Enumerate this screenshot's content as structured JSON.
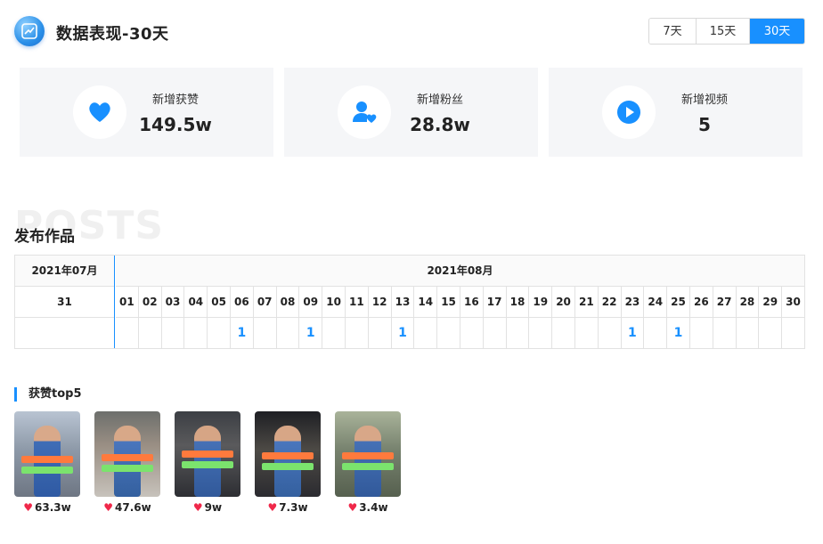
{
  "header": {
    "title": "数据表现-30天",
    "ranges": [
      "7天",
      "15天",
      "30天"
    ],
    "active_range": "30天"
  },
  "stats": [
    {
      "icon": "heart-icon",
      "label": "新增获赞",
      "value": "149.5w"
    },
    {
      "icon": "user-follow-icon",
      "label": "新增粉丝",
      "value": "28.8w"
    },
    {
      "icon": "play-icon",
      "label": "新增视频",
      "value": "5"
    }
  ],
  "posts": {
    "watermark": "POSTS",
    "title": "发布作品",
    "month_left": "2021年07月",
    "month_right": "2021年08月",
    "day_left": "31",
    "days": [
      "01",
      "02",
      "03",
      "04",
      "05",
      "06",
      "07",
      "08",
      "09",
      "10",
      "11",
      "12",
      "13",
      "14",
      "15",
      "16",
      "17",
      "18",
      "19",
      "20",
      "21",
      "22",
      "23",
      "24",
      "25",
      "26",
      "27",
      "28",
      "29",
      "30"
    ],
    "counts": [
      "",
      "",
      "",
      "",
      "",
      "1",
      "",
      "",
      "1",
      "",
      "",
      "",
      "1",
      "",
      "",
      "",
      "",
      "",
      "",
      "",
      "",
      "",
      "1",
      "",
      "1",
      "",
      "",
      "",
      "",
      ""
    ]
  },
  "top5": {
    "title": "获赞top5",
    "items": [
      {
        "likes": "63.3w"
      },
      {
        "likes": "47.6w"
      },
      {
        "likes": "9w"
      },
      {
        "likes": "7.3w"
      },
      {
        "likes": "3.4w"
      }
    ]
  },
  "colors": {
    "accent": "#1890ff",
    "heart": "#f0284a",
    "card_bg": "#f5f6f8"
  }
}
